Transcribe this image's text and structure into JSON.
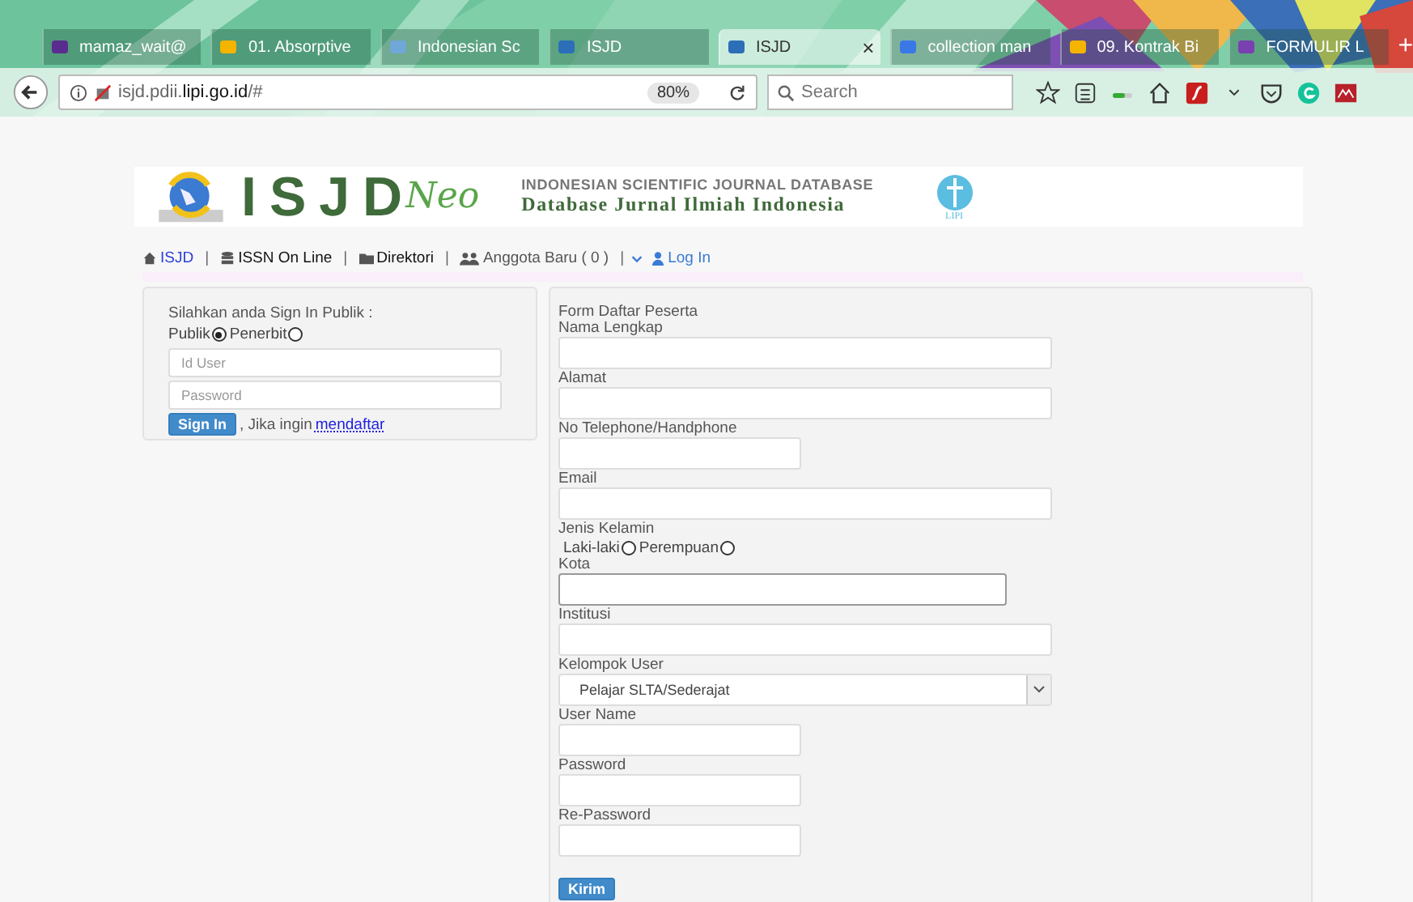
{
  "browser": {
    "tabs": [
      {
        "title": "mamaz_wait@",
        "selected": false
      },
      {
        "title": "01. Absorptive",
        "selected": false
      },
      {
        "title": "Indonesian Sc",
        "selected": false
      },
      {
        "title": "ISJD",
        "selected": false
      },
      {
        "title": "ISJD",
        "selected": true
      },
      {
        "title": "collection man",
        "selected": false
      },
      {
        "title": "09. Kontrak Bi",
        "selected": false
      },
      {
        "title": "FORMULIR L",
        "selected": false
      }
    ],
    "close": "×",
    "new_tab": "+",
    "url": "isjd.pdii.**lipi.go.id**/#",
    "zoom": "80%",
    "search": {
      "placeholder": "Search"
    }
  },
  "banner": {
    "logo": "ISJD",
    "logo_suffix": "Neo",
    "subtitle": "INDONESIAN SCIENTIFIC JOURNAL DATABASE",
    "tagline": "Database Jurnal Ilmiah Indonesia",
    "org": "LIPI"
  },
  "nav": [
    {
      "kind": "home",
      "label": "ISJD"
    },
    {
      "kind": "separator",
      "label": "|"
    },
    {
      "kind": "database",
      "label": "ISSN On Line"
    },
    {
      "kind": "separator",
      "label": "|"
    },
    {
      "kind": "folder",
      "label": "Direktori"
    },
    {
      "kind": "separator",
      "label": "|"
    },
    {
      "kind": "users",
      "label": "Anggota Baru ( 0 )"
    },
    {
      "kind": "separator",
      "label": "|"
    },
    {
      "kind": "caret"
    },
    {
      "kind": "user",
      "label": "Log In"
    }
  ],
  "login": {
    "prompt": "Silahkan anda Sign In Publik :",
    "options": [
      {
        "label": "Publik",
        "selected": true
      },
      {
        "label": "Penerbit",
        "selected": false
      }
    ],
    "fields": [
      {
        "placeholder": "Id User"
      },
      {
        "placeholder": "Password"
      }
    ],
    "button": "Sign In",
    "note": ", Jika ingin",
    "link": "mendaftar"
  },
  "registration": {
    "title": "Form Daftar Peserta",
    "fields": [
      {
        "label": "Nama Lengkap",
        "kind": "wide"
      },
      {
        "label": "Alamat",
        "kind": "wide"
      },
      {
        "label": "No Telephone/Handphone",
        "kind": "short"
      },
      {
        "label": "Email",
        "kind": "wide"
      },
      {
        "label": "Jenis Kelamin",
        "kind": "radio",
        "options": [
          {
            "label": "Laki-laki",
            "selected": false
          },
          {
            "label": "Perempuan",
            "selected": false
          }
        ]
      },
      {
        "label": "Kota",
        "kind": "medium"
      },
      {
        "label": "Institusi",
        "kind": "wide"
      },
      {
        "label": "Kelompok User",
        "kind": "select",
        "value": "Pelajar SLTA/Sederajat"
      },
      {
        "label": "User Name",
        "kind": "short"
      },
      {
        "label": "Password",
        "kind": "short"
      },
      {
        "label": "Re-Password",
        "kind": "short"
      }
    ],
    "button": "Kirim"
  }
}
